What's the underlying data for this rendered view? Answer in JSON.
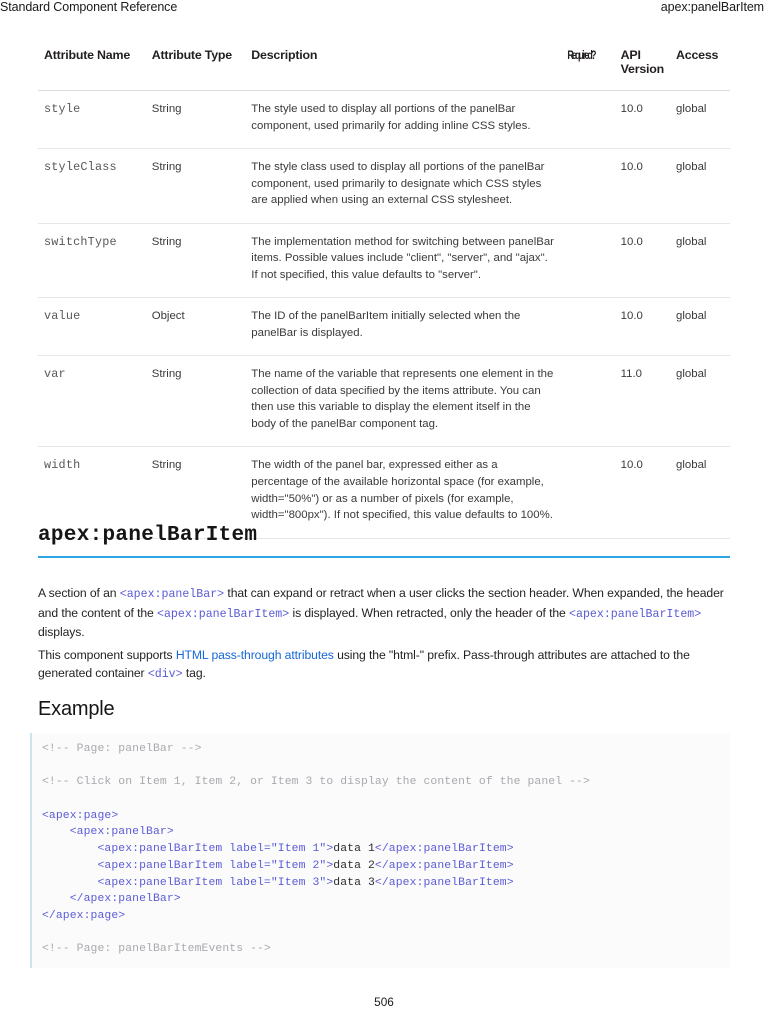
{
  "running_head": {
    "left": "Standard Component Reference",
    "right": "apex:panelBarItem"
  },
  "attributes_table": {
    "headers": {
      "name": "Attribute Name",
      "type": "Attribute Type",
      "description": "Description",
      "required": "Required?",
      "api_version_line1": "API",
      "api_version_line2": "Version",
      "access": "Access"
    },
    "rows": [
      {
        "name": "style",
        "type": "String",
        "description": "The style used to display all portions of the panelBar component, used primarily for adding inline CSS styles.",
        "required": "",
        "api_version": "10.0",
        "access": "global"
      },
      {
        "name": "styleClass",
        "type": "String",
        "description": "The style class used to display all portions of the panelBar component, used primarily to designate which CSS styles are applied when using an external CSS stylesheet.",
        "required": "",
        "api_version": "10.0",
        "access": "global"
      },
      {
        "name": "switchType",
        "type": "String",
        "description": "The implementation method for switching between panelBar items. Possible values include \"client\", \"server\", and \"ajax\". If not specified, this value defaults to \"server\".",
        "required": "",
        "api_version": "10.0",
        "access": "global"
      },
      {
        "name": "value",
        "type": "Object",
        "description": "The ID of the panelBarItem initially selected when the panelBar is displayed.",
        "required": "",
        "api_version": "10.0",
        "access": "global"
      },
      {
        "name": "var",
        "type": "String",
        "description": "The name of the variable that represents one element in the collection of data specified by the items attribute. You can then use this variable to display the element itself in the body of the panelBar component tag.",
        "required": "",
        "api_version": "11.0",
        "access": "global"
      },
      {
        "name": "width",
        "type": "String",
        "description": "The width of the panel bar, expressed either as a percentage of the available horizontal space (for example, width=\"50%\") or as a number of pixels (for example, width=\"800px\"). If not specified, this value defaults to 100%.",
        "required": "",
        "api_version": "10.0",
        "access": "global"
      }
    ]
  },
  "section": {
    "heading": "apex:panelBarItem",
    "accent_color": "#2ba6e0",
    "paragraph_1": {
      "part_1": "A section of an ",
      "code_1": "<apex:panelBar>",
      "part_2": " that can expand or retract when a user clicks the section header. When expanded, the header and the content of the ",
      "code_2": "<apex:panelBarItem>",
      "part_3": " is displayed. When retracted, only the header of the ",
      "code_3": "<apex:panelBarItem>",
      "part_4": " displays."
    },
    "paragraph_2": {
      "part_1": "This component supports ",
      "link_text": "HTML pass-through attributes",
      "part_2": " using the \"html-\" prefix. Pass-through attributes are attached to the generated container ",
      "code_1": "<div>",
      "part_3": " tag."
    }
  },
  "example": {
    "heading": "Example",
    "code": {
      "line_1": "<!-- Page: panelBar -->",
      "line_2": "<!-- Click on Item 1, Item 2, or Item 3 to display the content of the panel -->",
      "line_3": "<apex:page>",
      "line_4": "    <apex:panelBar>",
      "line_5_tag_open": "        <apex:panelBarItem label=\"Item 1\">",
      "line_5_text": "data 1",
      "line_5_tag_close": "</apex:panelBarItem>",
      "line_6_tag_open": "        <apex:panelBarItem label=\"Item 2\">",
      "line_6_text": "data 2",
      "line_6_tag_close": "</apex:panelBarItem>",
      "line_7_tag_open": "        <apex:panelBarItem label=\"Item 3\">",
      "line_7_text": "data 3",
      "line_7_tag_close": "</apex:panelBarItem>",
      "line_8": "    </apex:panelBar>",
      "line_9": "</apex:page>",
      "line_10": "<!-- Page: panelBarItemEvents -->"
    }
  },
  "folio": "506"
}
